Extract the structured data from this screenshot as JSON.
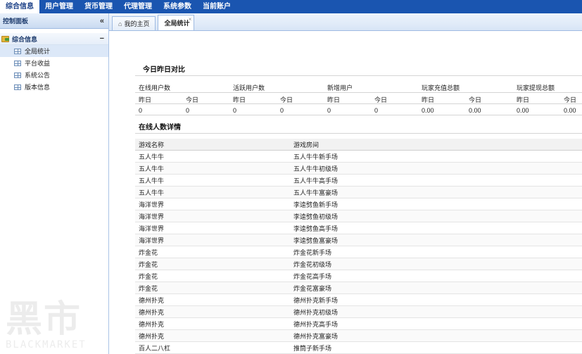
{
  "nav": [
    "综合信息",
    "用户管理",
    "货币管理",
    "代理管理",
    "系统参数",
    "当前账户"
  ],
  "sidebar": {
    "title": "控制面板",
    "collapse_glyph": "«",
    "group_label": "综合信息",
    "group_toggle": "−",
    "items": [
      "全局统计",
      "平台收益",
      "系统公告",
      "版本信息"
    ]
  },
  "watermark": {
    "glyphs": "黑市",
    "text": "BLACKMARKET"
  },
  "tabs": [
    {
      "label": "我的主页"
    },
    {
      "label": "全局统计",
      "close": "×"
    }
  ],
  "compare": {
    "title": "今日昨日对比",
    "groups": [
      "在线用户数",
      "活跃用户数",
      "新增用户",
      "玩家充值总额",
      "玩家提现总额"
    ],
    "subheaders": [
      "昨日",
      "今日",
      "昨日",
      "今日",
      "昨日",
      "今日",
      "昨日",
      "今日",
      "昨日",
      "今日"
    ],
    "values": [
      "0",
      "0",
      "0",
      "0",
      "0",
      "0",
      "0.00",
      "0.00",
      "0.00",
      "0.00"
    ]
  },
  "online": {
    "title": "在线人数详情",
    "headers": [
      "游戏名称",
      "游戏房间"
    ],
    "rows": [
      [
        "五人牛牛",
        "五人牛牛新手场"
      ],
      [
        "五人牛牛",
        "五人牛牛初级场"
      ],
      [
        "五人牛牛",
        "五人牛牛高手场"
      ],
      [
        "五人牛牛",
        "五人牛牛富豪场"
      ],
      [
        "海洋世界",
        "李逵劈鱼新手场"
      ],
      [
        "海洋世界",
        "李逵劈鱼初级场"
      ],
      [
        "海洋世界",
        "李逵劈鱼高手场"
      ],
      [
        "海洋世界",
        "李逵劈鱼富豪场"
      ],
      [
        "炸金花",
        "炸金花新手场"
      ],
      [
        "炸金花",
        "炸金花初级场"
      ],
      [
        "炸金花",
        "炸金花高手场"
      ],
      [
        "炸金花",
        "炸金花富豪场"
      ],
      [
        "德州扑克",
        "德州扑克新手场"
      ],
      [
        "德州扑克",
        "德州扑克初级场"
      ],
      [
        "德州扑克",
        "德州扑克高手场"
      ],
      [
        "德州扑克",
        "德州扑克富豪场"
      ],
      [
        "百人二八杠",
        "推筒子新手场"
      ]
    ]
  }
}
